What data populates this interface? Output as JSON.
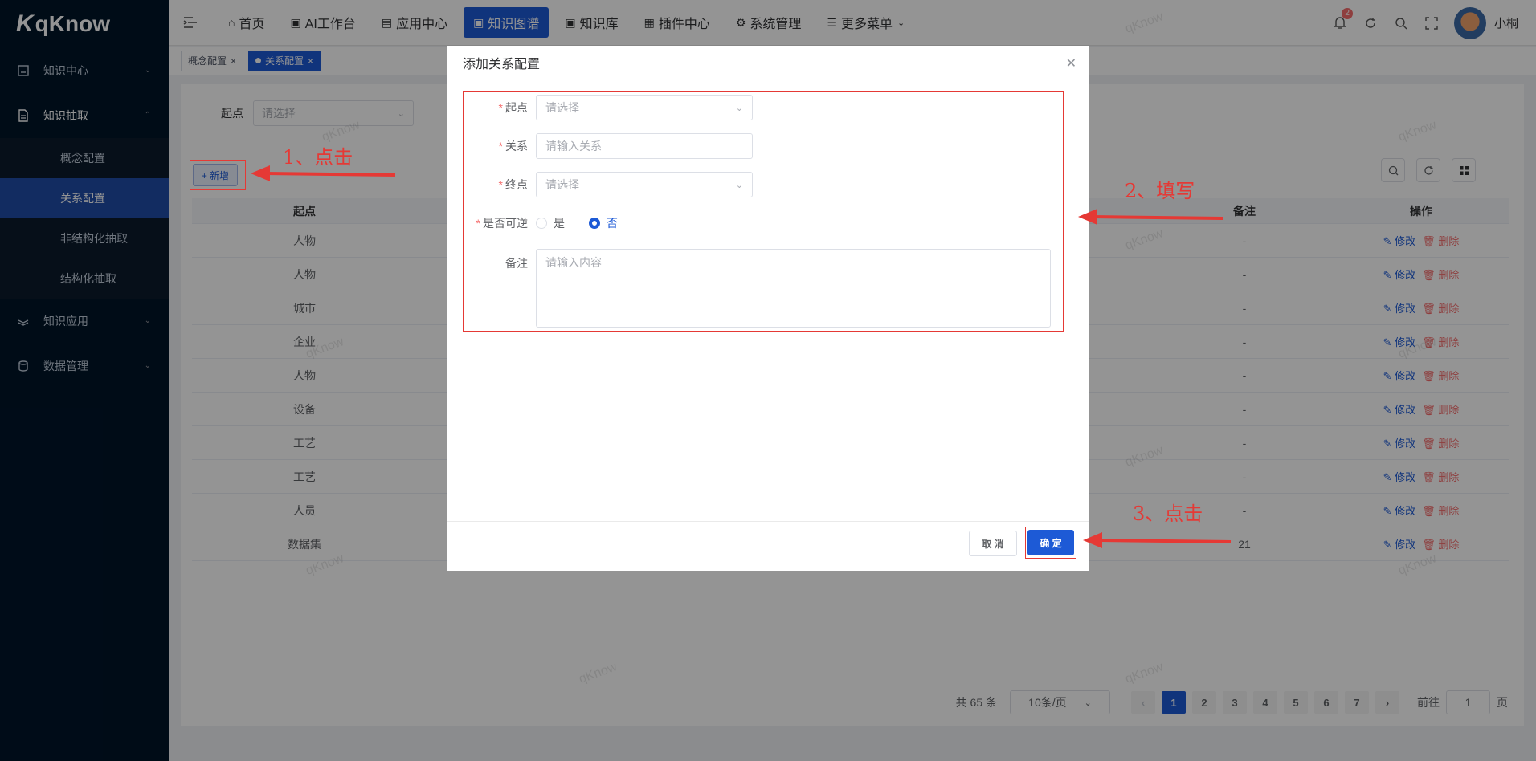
{
  "app": {
    "logo": "qKnow",
    "logo_mark": "K"
  },
  "sidebar": {
    "items": [
      {
        "label": "知识中心",
        "icon": "knowledge-center-icon"
      },
      {
        "label": "知识抽取",
        "icon": "extraction-icon",
        "open": true,
        "children": [
          "概念配置",
          "关系配置",
          "非结构化抽取",
          "结构化抽取"
        ]
      },
      {
        "label": "知识应用",
        "icon": "application-icon"
      },
      {
        "label": "数据管理",
        "icon": "data-icon"
      }
    ]
  },
  "header": {
    "nav": [
      "首页",
      "AI工作台",
      "应用中心",
      "知识图谱",
      "知识库",
      "插件中心",
      "系统管理",
      "更多菜单"
    ],
    "notification_count": "2",
    "username": "小桐"
  },
  "tags": [
    "概念配置",
    "关系配置"
  ],
  "search": {
    "label": "起点",
    "placeholder": "请选择"
  },
  "toolbar": {
    "add_label": "+ 新增"
  },
  "table": {
    "headers": {
      "start": "起点",
      "remark": "备注",
      "actions": "操作"
    },
    "rows": [
      {
        "start": "人物",
        "remark": "-"
      },
      {
        "start": "人物",
        "remark": "-"
      },
      {
        "start": "城市",
        "remark": "-"
      },
      {
        "start": "企业",
        "remark": "-"
      },
      {
        "start": "人物",
        "remark": "-"
      },
      {
        "start": "设备",
        "remark": "-"
      },
      {
        "start": "工艺",
        "remark": "-"
      },
      {
        "start": "工艺",
        "remark": "-"
      },
      {
        "start": "人员",
        "remark": "-"
      },
      {
        "start": "数据集",
        "remark": "21"
      }
    ],
    "edit_label": "修改",
    "delete_label": "删除"
  },
  "pagination": {
    "total": "共 65 条",
    "page_size": "10条/页",
    "pages": [
      "1",
      "2",
      "3",
      "4",
      "5",
      "6",
      "7"
    ],
    "jump_prefix": "前往",
    "jump_value": "1",
    "jump_suffix": "页"
  },
  "watermark": "qKnow",
  "dialog": {
    "title": "添加关系配置",
    "fields": {
      "start": {
        "label": "起点",
        "placeholder": "请选择"
      },
      "relation": {
        "label": "关系",
        "placeholder": "请输入关系"
      },
      "end": {
        "label": "终点",
        "placeholder": "请选择"
      },
      "reversible": {
        "label": "是否可逆",
        "options": [
          "是",
          "否"
        ],
        "selected": "否"
      },
      "remark": {
        "label": "备注",
        "placeholder": "请输入内容"
      }
    },
    "cancel_label": "取 消",
    "confirm_label": "确 定"
  },
  "annotations": {
    "step1": "1、点击",
    "step2": "2、填写",
    "step3": "3、点击",
    "color": "#e53935"
  }
}
